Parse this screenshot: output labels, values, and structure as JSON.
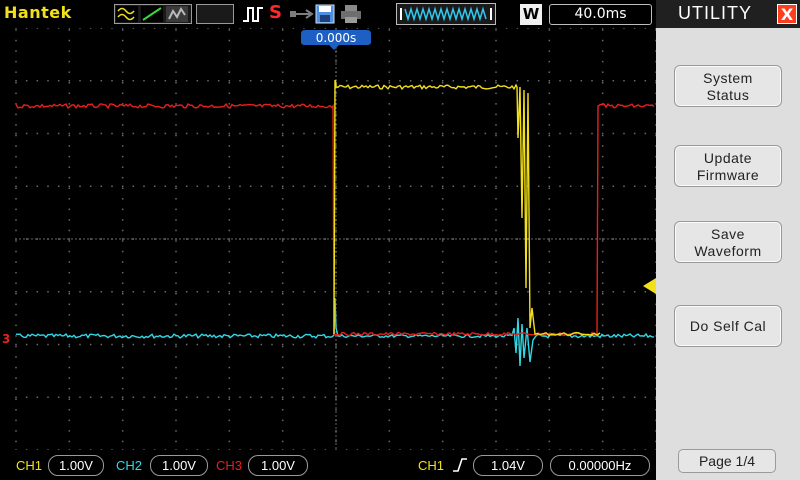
{
  "topbar": {
    "brand": "Hantek",
    "run_state": "S",
    "mode": "W",
    "timebase": "40.0ms"
  },
  "display": {
    "trigger_position": "0.000s",
    "ch3_marker": "3"
  },
  "channels": [
    {
      "label": "CH1",
      "scale": "1.00V",
      "color": "#f2e01a"
    },
    {
      "label": "CH2",
      "scale": "1.00V",
      "color": "#31d9e6"
    },
    {
      "label": "CH3",
      "scale": "1.00V",
      "color": "#e8201c"
    }
  ],
  "trigger": {
    "source": "CH1",
    "level": "1.04V",
    "frequency": "0.00000Hz"
  },
  "menu": {
    "title": "UTILITY",
    "close": "X",
    "items": [
      {
        "label_line1": "System",
        "label_line2": "Status"
      },
      {
        "label_line1": "Update",
        "label_line2": "Firmware"
      },
      {
        "label_line1": "Save",
        "label_line2": "Waveform"
      },
      {
        "label": "Do Self Cal"
      }
    ],
    "page": "Page 1/4"
  },
  "colors": {
    "ch1": "#f2e01a",
    "ch2": "#31d9e6",
    "ch3": "#e8201c",
    "grid": "#707070",
    "menu_bg": "#dedede"
  }
}
